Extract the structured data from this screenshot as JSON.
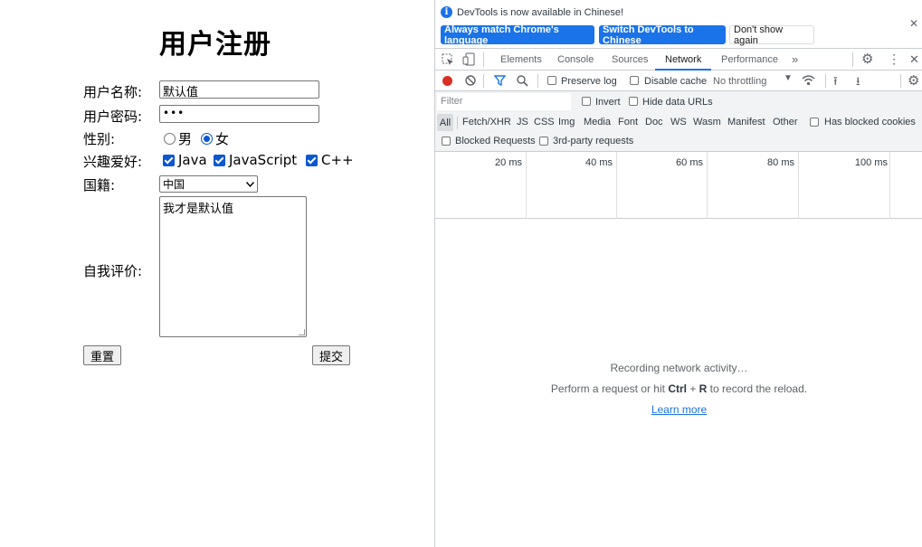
{
  "form": {
    "title": "用户注册",
    "username_label": "用户名称:",
    "username_value": "默认值",
    "password_label": "用户密码:",
    "password_value": "•••",
    "gender_label": "性别:",
    "gender_male": "男",
    "gender_female": "女",
    "gender_selected": "女",
    "hobby_label": "兴趣爱好:",
    "hobbies": [
      "Java",
      "JavaScript",
      "C++"
    ],
    "hobbies_checked": [
      true,
      true,
      true
    ],
    "country_label": "国籍:",
    "country_value": "中国",
    "intro_label": "自我评价:",
    "intro_value": "我才是默认值",
    "reset_label": "重置",
    "submit_label": "提交"
  },
  "devtools": {
    "info_text": "DevTools is now available in Chinese!",
    "info_btn_match": "Always match Chrome's language",
    "info_btn_switch": "Switch DevTools to Chinese",
    "info_btn_dismiss": "Don't show again",
    "tabs": [
      "Elements",
      "Console",
      "Sources",
      "Network",
      "Performance"
    ],
    "active_tab": "Network",
    "preserve_log": "Preserve log",
    "disable_cache": "Disable cache",
    "throttling": "No throttling",
    "filter_placeholder": "Filter",
    "invert": "Invert",
    "hide_data_urls": "Hide data URLs",
    "types": [
      "All",
      "Fetch/XHR",
      "JS",
      "CSS",
      "Img",
      "Media",
      "Font",
      "Doc",
      "WS",
      "Wasm",
      "Manifest",
      "Other"
    ],
    "has_blocked_cookies": "Has blocked cookies",
    "blocked_requests": "Blocked Requests",
    "third_party": "3rd-party requests",
    "timeline_ticks": [
      "20 ms",
      "40 ms",
      "60 ms",
      "80 ms",
      "100 ms"
    ],
    "recording": "Recording network activity…",
    "hint_prefix": "Perform a request or hit ",
    "hint_key1": "Ctrl",
    "hint_plus": " + ",
    "hint_key2": "R",
    "hint_suffix": " to record the reload.",
    "learn_more": "Learn more",
    "colors": {
      "accent": "#1a73e8",
      "record": "#d93025"
    },
    "icons": [
      "info-icon",
      "close-icon",
      "inspect-icon",
      "device-icon",
      "gear-icon",
      "kebab-icon",
      "record-icon",
      "clear-icon",
      "filter-icon",
      "search-icon",
      "wifi-icon",
      "upload-icon",
      "download-icon",
      "chevron-right-icon",
      "dropdown-icon"
    ]
  }
}
